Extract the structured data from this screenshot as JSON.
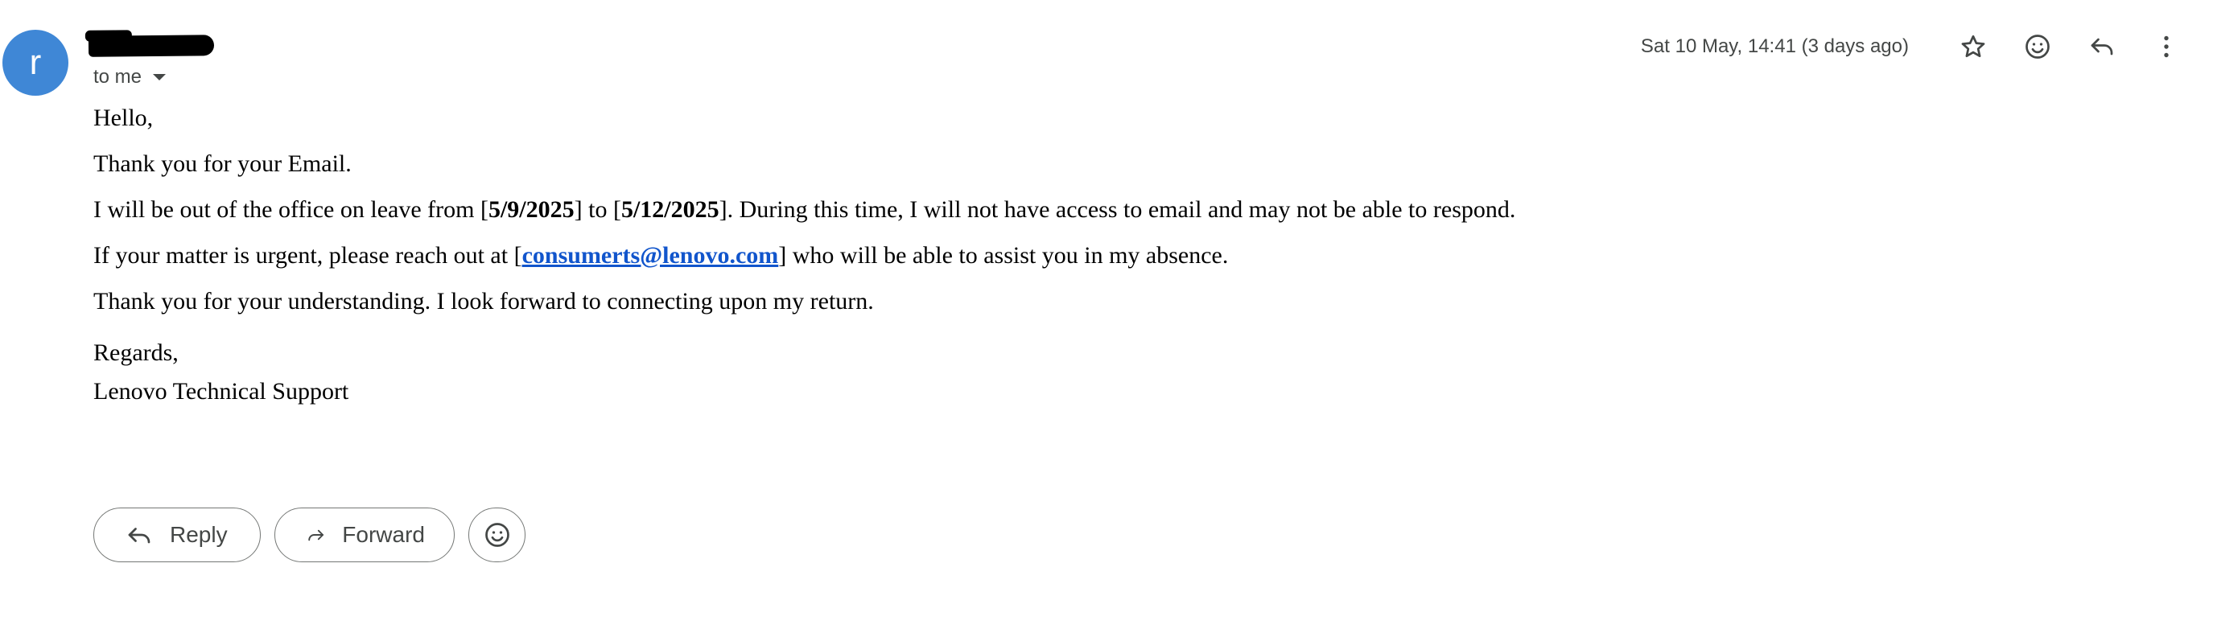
{
  "sender": {
    "avatar_letter": "r",
    "avatar_color": "#3f87d6",
    "recipient_label": "to me"
  },
  "header": {
    "timestamp": "Sat 10 May, 14:41 (3 days ago)",
    "icons": [
      "star-icon",
      "emoji-react-icon",
      "reply-icon",
      "more-vert-icon"
    ]
  },
  "message": {
    "greeting": "Hello,",
    "line1": "Thank you for your Email.",
    "line2_pre": "I will be out of the office on leave from [",
    "line2_date1": "5/9/2025",
    "line2_mid": "] to [",
    "line2_date2": "5/12/2025",
    "line2_post": "]. During this time, I will not have access to email and may not be able to respond.",
    "line3_pre": "If your matter is urgent, please reach out at [",
    "line3_email": "consumerts@lenovo.com",
    "line3_post": "] who will be able to assist you in my absence.",
    "line4": "Thank you for your understanding. I look forward to connecting upon my return.",
    "signoff": "Regards,",
    "signature": "Lenovo Technical Support"
  },
  "actions": {
    "reply_label": "Reply",
    "forward_label": "Forward"
  },
  "colors": {
    "link": "#1155cc",
    "secondary_text": "#444746",
    "pill_border": "#747775"
  }
}
